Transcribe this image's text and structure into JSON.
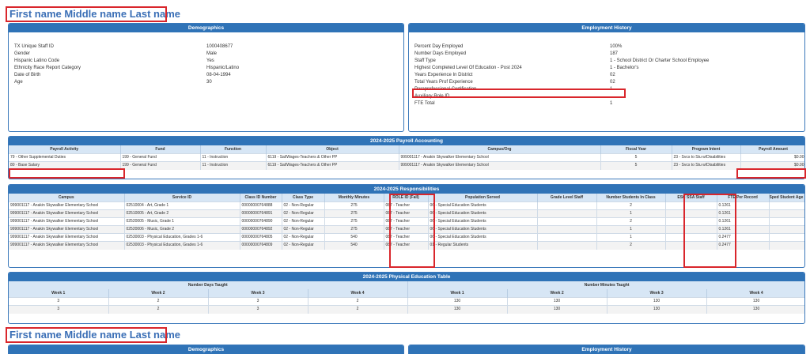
{
  "person": {
    "name": "First name Middle name Last name"
  },
  "demographics": {
    "title": "Demographics",
    "rows": [
      {
        "label": "TX Unique Staff ID",
        "value": "1000408677"
      },
      {
        "label": "Gender",
        "value": "Male"
      },
      {
        "label": "Hispanic Latino Code",
        "value": "Yes"
      },
      {
        "label": "Ethnicity Race Report Category",
        "value": "Hispanic/Latino"
      },
      {
        "label": "Date of Birth",
        "value": "08-04-1994"
      },
      {
        "label": "Age",
        "value": "30"
      }
    ]
  },
  "employment": {
    "title": "Employment History",
    "rows": [
      {
        "label": "Percent Day Employed",
        "value": "100%"
      },
      {
        "label": "Number Days Employed",
        "value": "187"
      },
      {
        "label": "Staff Type",
        "value": "1 - School District Or Charter School Employee"
      },
      {
        "label": "Highest Completed Level Of Education - Post 2024",
        "value": "1 - Bachelor's"
      },
      {
        "label": "Years Experience In District",
        "value": "02"
      },
      {
        "label": "Total Years Prof Experience",
        "value": "02"
      },
      {
        "label": "Paraprofessional Certification",
        "value": "1"
      },
      {
        "label": "Auxiliary Role ID",
        "value": ""
      },
      {
        "label": "FTE Total",
        "value": "1"
      }
    ]
  },
  "payroll": {
    "title": "2024-2025 Payroll Accounting",
    "headers": [
      "Payroll Activity",
      "Fund",
      "Function",
      "Object",
      "Campus/Org",
      "Fiscal Year",
      "Program Intent",
      "Payroll Amount"
    ],
    "rows": [
      [
        "79 - Other Supplemental Duties",
        "199 - General Fund",
        "11 - Instruction",
        "6119 - Sal/Wages-Teachers & Other PP",
        "999001117 - Anakin Skywalker Elementary School",
        "5",
        "23 - Svcs to Stu w/Disabilities",
        "$0.00"
      ],
      [
        "80 - Base Salary",
        "199 - General Fund",
        "11 - Instruction",
        "6119 - Sal/Wages-Teachers & Other PP",
        "999001117 - Anakin Skywalker Elementary School",
        "5",
        "23 - Svcs to Stu w/Disabilities",
        "$0.00"
      ]
    ]
  },
  "responsibilities": {
    "title": "2024-2025 Responsibilities",
    "headers": [
      "Campus",
      "Service ID",
      "Class ID Number",
      "Class Type",
      "Monthly Minutes",
      "ROLE ID (Fall)",
      "Population Served",
      "Grade Level Staff",
      "Number Students In Class",
      "ESC SSA Staff",
      "FTE Per Record",
      "Sped Student Age Range"
    ],
    "rows": [
      [
        "999001117 - Anakin Skywalker Elementary School",
        "02510004 - Art, Grade 1",
        "00000000764888",
        "02 - Non-Regular",
        "275",
        "087 - Teacher",
        "06 - Special Education Students",
        "",
        "2",
        "",
        "0.1261",
        ""
      ],
      [
        "999001117 - Anakin Skywalker Elementary School",
        "02510005 - Art, Grade 2",
        "00000000764891",
        "02 - Non-Regular",
        "275",
        "087 - Teacher",
        "06 - Special Education Students",
        "",
        "1",
        "",
        "0.1261",
        ""
      ],
      [
        "999001117 - Anakin Skywalker Elementary School",
        "02520005 - Music, Grade 1",
        "00000000764890",
        "02 - Non-Regular",
        "275",
        "087 - Teacher",
        "06 - Special Education Students",
        "",
        "2",
        "",
        "0.1261",
        ""
      ],
      [
        "999001117 - Anakin Skywalker Elementary School",
        "02520006 - Music, Grade 2",
        "00000000764892",
        "02 - Non-Regular",
        "275",
        "087 - Teacher",
        "06 - Special Education Students",
        "",
        "1",
        "",
        "0.1261",
        ""
      ],
      [
        "999001117 - Anakin Skywalker Elementary School",
        "02530003 - Physical Education, Grades 1-6",
        "00000000764805",
        "02 - Non-Regular",
        "540",
        "087 - Teacher",
        "06 - Special Education Students",
        "",
        "1",
        "",
        "0.2477",
        ""
      ],
      [
        "999001117 - Anakin Skywalker Elementary School",
        "02530003 - Physical Education, Grades 1-6",
        "00000000764809",
        "02 - Non-Regular",
        "540",
        "087 - Teacher",
        "01 - Regular Students",
        "",
        "2",
        "",
        "0.2477",
        ""
      ]
    ]
  },
  "pe": {
    "title": "2024-2025 Physical Education Table",
    "group_days": "Number Days Taught",
    "group_minutes": "Number Minutes Taught",
    "headers": [
      "Week 1",
      "Week 2",
      "Week 3",
      "Week 4",
      "Week 1",
      "Week 2",
      "Week 3",
      "Week 4"
    ],
    "rows": [
      [
        "3",
        "2",
        "3",
        "2",
        "130",
        "130",
        "130",
        "130"
      ],
      [
        "3",
        "2",
        "3",
        "2",
        "130",
        "130",
        "130",
        "130"
      ]
    ]
  },
  "bottom": {
    "name": "First name Middle name Last name",
    "demographics_title": "Demographics",
    "employment_title": "Employment History"
  },
  "colors": {
    "header": "#2f73b7",
    "highlight": "#d9262c",
    "title": "#3b6fb6"
  }
}
